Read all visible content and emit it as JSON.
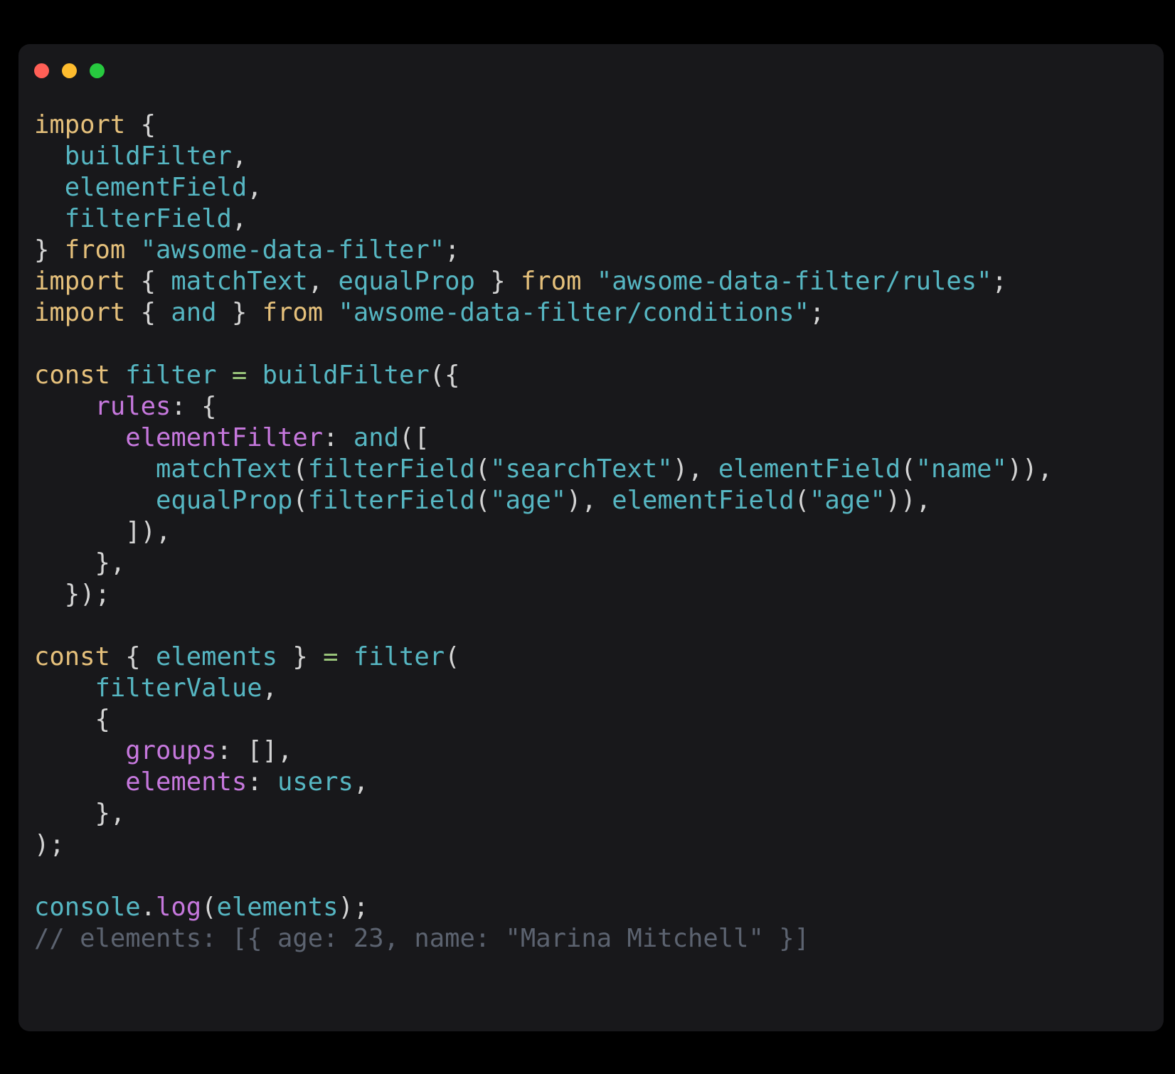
{
  "window": {
    "background_color": "#18181B",
    "page_background_color": "#000000",
    "traffic_lights": [
      {
        "name": "close-button",
        "color": "#FF5F56"
      },
      {
        "name": "minimize-button",
        "color": "#FEBC2E"
      },
      {
        "name": "maximize-button",
        "color": "#27C93F"
      }
    ]
  },
  "theme": {
    "plain": "#D4D4D4",
    "keyword": "#E5C07B",
    "identifier": "#56B6C2",
    "function": "#61AFEF",
    "property": "#C678DD",
    "operator": "#98C379",
    "comment": "#5C6370",
    "punctuation": "#D4D4D4"
  },
  "code": {
    "language": "javascript",
    "plain_text": "import {\n  buildFilter,\n  elementField,\n  filterField,\n} from \"awsome-data-filter\";\nimport { matchText, equalProp } from \"awsome-data-filter/rules\";\nimport { and } from \"awsome-data-filter/conditions\";\n\nconst filter = buildFilter({\n    rules: {\n      elementFilter: and([\n        matchText(filterField(\"searchText\"), elementField(\"name\")),\n        equalProp(filterField(\"age\"), elementField(\"age\")),\n      ]),\n    },\n  });\n\nconst { elements } = filter(\n    filterValue,\n    {\n      groups: [],\n      elements: users,\n    },\n);\n\nconsole.log(elements);\n// elements: [{ age: 23, name: \"Marina Mitchell\" }]",
    "lines": [
      [
        {
          "t": "import",
          "c": "keyword"
        },
        {
          "t": " ",
          "c": "plain"
        },
        {
          "t": "{",
          "c": "punctuation"
        }
      ],
      [
        {
          "t": "  ",
          "c": "plain"
        },
        {
          "t": "buildFilter",
          "c": "identifier"
        },
        {
          "t": ",",
          "c": "punctuation"
        }
      ],
      [
        {
          "t": "  ",
          "c": "plain"
        },
        {
          "t": "elementField",
          "c": "identifier"
        },
        {
          "t": ",",
          "c": "punctuation"
        }
      ],
      [
        {
          "t": "  ",
          "c": "plain"
        },
        {
          "t": "filterField",
          "c": "identifier"
        },
        {
          "t": ",",
          "c": "punctuation"
        }
      ],
      [
        {
          "t": "}",
          "c": "punctuation"
        },
        {
          "t": " ",
          "c": "plain"
        },
        {
          "t": "from",
          "c": "keyword"
        },
        {
          "t": " ",
          "c": "plain"
        },
        {
          "t": "\"awsome-data-filter\"",
          "c": "identifier"
        },
        {
          "t": ";",
          "c": "punctuation"
        }
      ],
      [
        {
          "t": "import",
          "c": "keyword"
        },
        {
          "t": " ",
          "c": "plain"
        },
        {
          "t": "{",
          "c": "punctuation"
        },
        {
          "t": " ",
          "c": "plain"
        },
        {
          "t": "matchText",
          "c": "identifier"
        },
        {
          "t": ",",
          "c": "punctuation"
        },
        {
          "t": " ",
          "c": "plain"
        },
        {
          "t": "equalProp",
          "c": "identifier"
        },
        {
          "t": " ",
          "c": "plain"
        },
        {
          "t": "}",
          "c": "punctuation"
        },
        {
          "t": " ",
          "c": "plain"
        },
        {
          "t": "from",
          "c": "keyword"
        },
        {
          "t": " ",
          "c": "plain"
        },
        {
          "t": "\"awsome-data-filter/rules\"",
          "c": "identifier"
        },
        {
          "t": ";",
          "c": "punctuation"
        }
      ],
      [
        {
          "t": "import",
          "c": "keyword"
        },
        {
          "t": " ",
          "c": "plain"
        },
        {
          "t": "{",
          "c": "punctuation"
        },
        {
          "t": " ",
          "c": "plain"
        },
        {
          "t": "and",
          "c": "identifier"
        },
        {
          "t": " ",
          "c": "plain"
        },
        {
          "t": "}",
          "c": "punctuation"
        },
        {
          "t": " ",
          "c": "plain"
        },
        {
          "t": "from",
          "c": "keyword"
        },
        {
          "t": " ",
          "c": "plain"
        },
        {
          "t": "\"awsome-data-filter/conditions\"",
          "c": "identifier"
        },
        {
          "t": ";",
          "c": "punctuation"
        }
      ],
      [
        {
          "t": "",
          "c": "plain"
        }
      ],
      [
        {
          "t": "const",
          "c": "keyword"
        },
        {
          "t": " ",
          "c": "plain"
        },
        {
          "t": "filter",
          "c": "identifier"
        },
        {
          "t": " ",
          "c": "plain"
        },
        {
          "t": "=",
          "c": "operator"
        },
        {
          "t": " ",
          "c": "plain"
        },
        {
          "t": "buildFilter",
          "c": "identifier"
        },
        {
          "t": "({",
          "c": "punctuation"
        }
      ],
      [
        {
          "t": "    ",
          "c": "plain"
        },
        {
          "t": "rules",
          "c": "property"
        },
        {
          "t": ": {",
          "c": "punctuation"
        }
      ],
      [
        {
          "t": "      ",
          "c": "plain"
        },
        {
          "t": "elementFilter",
          "c": "property"
        },
        {
          "t": ": ",
          "c": "punctuation"
        },
        {
          "t": "and",
          "c": "identifier"
        },
        {
          "t": "([",
          "c": "punctuation"
        }
      ],
      [
        {
          "t": "        ",
          "c": "plain"
        },
        {
          "t": "matchText",
          "c": "identifier"
        },
        {
          "t": "(",
          "c": "punctuation"
        },
        {
          "t": "filterField",
          "c": "identifier"
        },
        {
          "t": "(",
          "c": "punctuation"
        },
        {
          "t": "\"searchText\"",
          "c": "identifier"
        },
        {
          "t": "), ",
          "c": "punctuation"
        },
        {
          "t": "elementField",
          "c": "identifier"
        },
        {
          "t": "(",
          "c": "punctuation"
        },
        {
          "t": "\"name\"",
          "c": "identifier"
        },
        {
          "t": ")),",
          "c": "punctuation"
        }
      ],
      [
        {
          "t": "        ",
          "c": "plain"
        },
        {
          "t": "equalProp",
          "c": "identifier"
        },
        {
          "t": "(",
          "c": "punctuation"
        },
        {
          "t": "filterField",
          "c": "identifier"
        },
        {
          "t": "(",
          "c": "punctuation"
        },
        {
          "t": "\"age\"",
          "c": "identifier"
        },
        {
          "t": "), ",
          "c": "punctuation"
        },
        {
          "t": "elementField",
          "c": "identifier"
        },
        {
          "t": "(",
          "c": "punctuation"
        },
        {
          "t": "\"age\"",
          "c": "identifier"
        },
        {
          "t": ")),",
          "c": "punctuation"
        }
      ],
      [
        {
          "t": "      ]),",
          "c": "punctuation"
        }
      ],
      [
        {
          "t": "    },",
          "c": "punctuation"
        }
      ],
      [
        {
          "t": "  });",
          "c": "punctuation"
        }
      ],
      [
        {
          "t": "",
          "c": "plain"
        }
      ],
      [
        {
          "t": "const",
          "c": "keyword"
        },
        {
          "t": " ",
          "c": "plain"
        },
        {
          "t": "{",
          "c": "punctuation"
        },
        {
          "t": " ",
          "c": "plain"
        },
        {
          "t": "elements",
          "c": "identifier"
        },
        {
          "t": " ",
          "c": "plain"
        },
        {
          "t": "}",
          "c": "punctuation"
        },
        {
          "t": " ",
          "c": "plain"
        },
        {
          "t": "=",
          "c": "operator"
        },
        {
          "t": " ",
          "c": "plain"
        },
        {
          "t": "filter",
          "c": "identifier"
        },
        {
          "t": "(",
          "c": "punctuation"
        }
      ],
      [
        {
          "t": "    ",
          "c": "plain"
        },
        {
          "t": "filterValue",
          "c": "identifier"
        },
        {
          "t": ",",
          "c": "punctuation"
        }
      ],
      [
        {
          "t": "    {",
          "c": "punctuation"
        }
      ],
      [
        {
          "t": "      ",
          "c": "plain"
        },
        {
          "t": "groups",
          "c": "property"
        },
        {
          "t": ": [],",
          "c": "punctuation"
        }
      ],
      [
        {
          "t": "      ",
          "c": "plain"
        },
        {
          "t": "elements",
          "c": "property"
        },
        {
          "t": ": ",
          "c": "punctuation"
        },
        {
          "t": "users",
          "c": "identifier"
        },
        {
          "t": ",",
          "c": "punctuation"
        }
      ],
      [
        {
          "t": "    },",
          "c": "punctuation"
        }
      ],
      [
        {
          "t": ");",
          "c": "punctuation"
        }
      ],
      [
        {
          "t": "",
          "c": "plain"
        }
      ],
      [
        {
          "t": "console",
          "c": "identifier"
        },
        {
          "t": ".",
          "c": "punctuation"
        },
        {
          "t": "log",
          "c": "property"
        },
        {
          "t": "(",
          "c": "punctuation"
        },
        {
          "t": "elements",
          "c": "identifier"
        },
        {
          "t": ");",
          "c": "punctuation"
        }
      ],
      [
        {
          "t": "// elements: [{ age: 23, name: \"Marina Mitchell\" }]",
          "c": "comment"
        }
      ]
    ]
  }
}
